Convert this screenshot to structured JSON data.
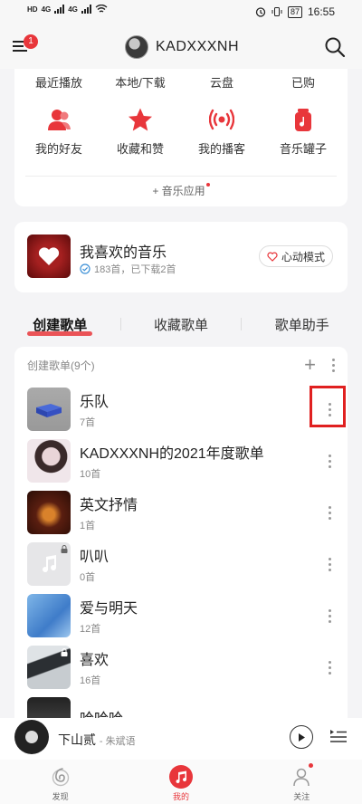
{
  "status_bar": {
    "left_labels": [
      "HD",
      "4G",
      "HD",
      "4G"
    ],
    "alarm_icon": "alarm-icon",
    "battery": "87",
    "time": "16:55"
  },
  "header": {
    "menu_badge": "1",
    "username": "KADXXXNH"
  },
  "shortcuts": {
    "row1": [
      "最近播放",
      "本地/下载",
      "云盘",
      "已购"
    ],
    "row2": [
      {
        "label": "我的好友",
        "icon": "friends-icon"
      },
      {
        "label": "收藏和赞",
        "icon": "star-icon"
      },
      {
        "label": "我的播客",
        "icon": "podcast-icon"
      },
      {
        "label": "音乐罐子",
        "icon": "music-jar-icon"
      }
    ],
    "apps_label": "音乐应用"
  },
  "liked": {
    "title": "我喜欢的音乐",
    "subtitle": "183首，已下载2首",
    "mode_label": "心动模式"
  },
  "tabs": [
    "创建歌单",
    "收藏歌单",
    "歌单助手"
  ],
  "playlists": {
    "header": "创建歌单(9个)",
    "items": [
      {
        "name": "乐队",
        "count": "7首"
      },
      {
        "name": "KADXXXNH的2021年度歌单",
        "count": "10首"
      },
      {
        "name": "英文抒情",
        "count": "1首"
      },
      {
        "name": "叭叭",
        "count": "0首"
      },
      {
        "name": "爱与明天",
        "count": "12首"
      },
      {
        "name": "喜欢",
        "count": "16首"
      },
      {
        "name": "哈哈哈",
        "count": ""
      }
    ]
  },
  "player": {
    "title": "下山贰",
    "artist": "- 朱斌语"
  },
  "bottom_nav": [
    {
      "label": "发现",
      "icon": "discover-icon"
    },
    {
      "label": "我的",
      "icon": "my-music-icon"
    },
    {
      "label": "关注",
      "icon": "follow-icon"
    }
  ],
  "colors": {
    "accent": "#e8363b",
    "highlight_box": "#e02020"
  }
}
